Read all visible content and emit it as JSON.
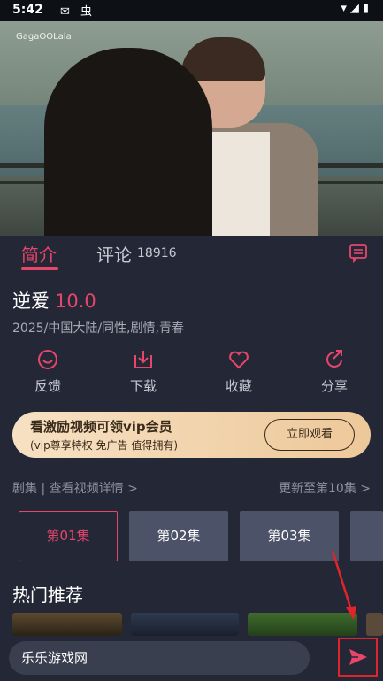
{
  "status_bar": {
    "time": "5:42",
    "left_icons": [
      "message-icon",
      "bug-icon"
    ],
    "left_icons_text": "✉ 虫",
    "right_icons": [
      "wifi-icon",
      "signal-icon",
      "battery-icon"
    ],
    "right_icons_text": "▾◢▮"
  },
  "video": {
    "watermark": "GagaOOLala"
  },
  "tabs": {
    "intro": "简介",
    "comments": "评论",
    "comments_count": "18916"
  },
  "show": {
    "title": "逆爱",
    "score": "10.0",
    "meta": "2025/中国大陆/同性,剧情,青春"
  },
  "actions": [
    {
      "label": "反馈",
      "icon": "feedback-icon"
    },
    {
      "label": "下载",
      "icon": "download-icon"
    },
    {
      "label": "收藏",
      "icon": "heart-icon"
    },
    {
      "label": "分享",
      "icon": "share-icon"
    }
  ],
  "vip_banner": {
    "title": "看激励视频可领vip会员",
    "subtitle": "(vip尊享特权 免广告 值得拥有)",
    "button": "立即观看"
  },
  "episodes": {
    "header_left": "剧集 | 查看视频详情 >",
    "header_right": "更新至第10集 >",
    "items": [
      "第01集",
      "第02集",
      "第03集"
    ],
    "selected": "第01集"
  },
  "hot": {
    "title": "热门推荐"
  },
  "bottom": {
    "input_value": "乐乐游戏网"
  },
  "colors": {
    "accent": "#e8456b",
    "background": "#242836",
    "episode_bg": "#4c5268",
    "highlight_box": "#e1242a"
  }
}
